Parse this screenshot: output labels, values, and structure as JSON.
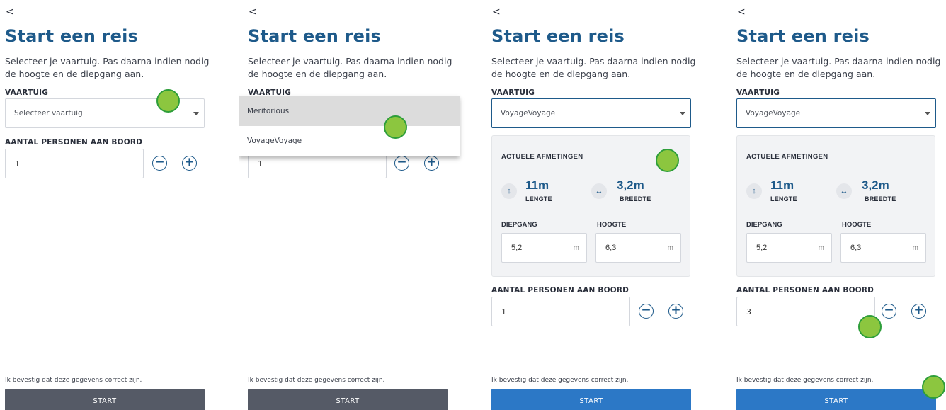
{
  "screens": [
    {
      "back": "<",
      "title": "Start een reis",
      "intro": "Selecteer je vaartuig. Pas daarna indien nodig de hoogte en de diepgang aan.",
      "vessel_label": "VAARTUIG",
      "vessel_value": "Selecteer vaartuig",
      "persons_label": "AANTAL PERSONEN AAN BOORD",
      "persons_value": "1",
      "minus": "−",
      "plus": "+",
      "confirm": "Ik bevestig dat deze gegevens correct zijn.",
      "start": "START"
    },
    {
      "back": "<",
      "title": "Start een reis",
      "intro": "Selecteer je vaartuig. Pas daarna indien nodig de hoogte en de diepgang aan.",
      "vessel_label": "VAARTUIG",
      "options": [
        "Meritorious",
        "VoyageVoyage"
      ],
      "persons_value": "1",
      "minus": "−",
      "plus": "+",
      "confirm": "Ik bevestig dat deze gegevens correct zijn.",
      "start": "START"
    },
    {
      "back": "<",
      "title": "Start een reis",
      "intro": "Selecteer je vaartuig. Pas daarna indien nodig de hoogte en de diepgang aan.",
      "vessel_label": "VAARTUIG",
      "vessel_value": "VoyageVoyage",
      "dims_title": "ACTUELE AFMETINGEN",
      "length_value": "11m",
      "length_label": "LENGTE",
      "width_value": "3,2m",
      "width_label": "BREEDTE",
      "draft_label": "DIEPGANG",
      "draft_value": "5,2",
      "height_label": "HOOGTE",
      "height_value": "6,3",
      "unit": "m",
      "persons_label": "AANTAL PERSONEN AAN BOORD",
      "persons_value": "1",
      "minus": "−",
      "plus": "+",
      "confirm": "Ik bevestig dat deze gegevens correct zijn.",
      "start": "START"
    },
    {
      "back": "<",
      "title": "Start een reis",
      "intro": "Selecteer je vaartuig. Pas daarna indien nodig de hoogte en de diepgang aan.",
      "vessel_label": "VAARTUIG",
      "vessel_value": "VoyageVoyage",
      "dims_title": "ACTUELE AFMETINGEN",
      "length_value": "11m",
      "length_label": "LENGTE",
      "width_value": "3,2m",
      "width_label": "BREEDTE",
      "draft_label": "DIEPGANG",
      "draft_value": "5,2",
      "height_label": "HOOGTE",
      "height_value": "6,3",
      "unit": "m",
      "persons_label": "AANTAL PERSONEN AAN BOORD",
      "persons_value": "3",
      "minus": "−",
      "plus": "+",
      "confirm": "Ik bevestig dat deze gegevens correct zijn.",
      "start": "START"
    }
  ],
  "icons": {
    "length": "vertical-arrow-icon",
    "width": "horizontal-arrow-icon"
  },
  "colors": {
    "title": "#1e5a8a",
    "start_disabled": "#555a66",
    "start_enabled": "#2c78c6",
    "marker": "#8cc63f"
  }
}
